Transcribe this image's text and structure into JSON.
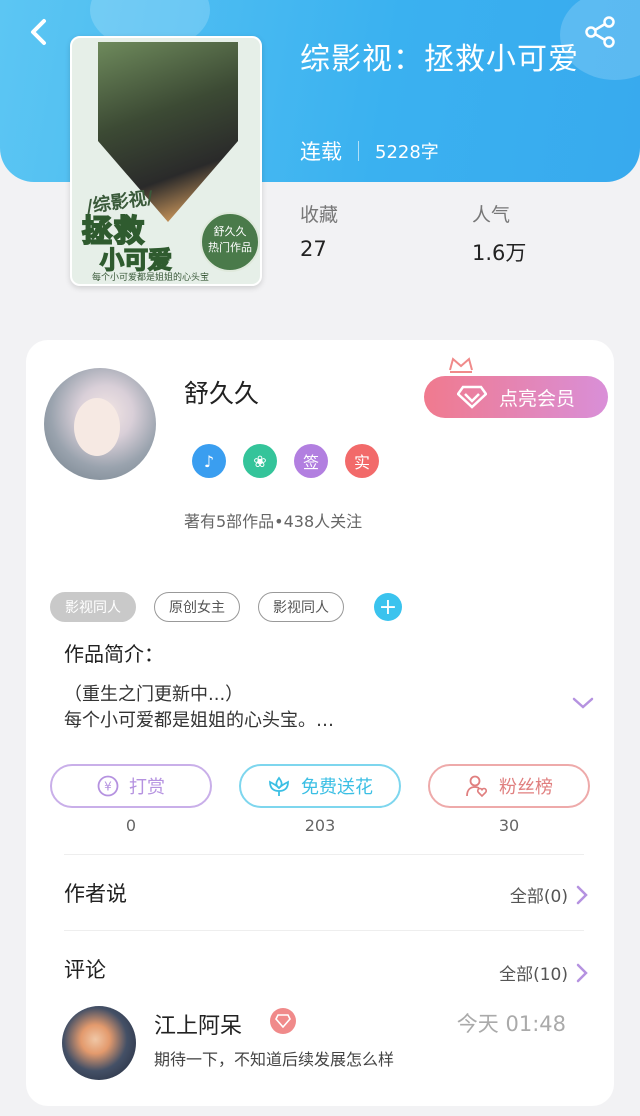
{
  "header": {
    "back_icon": "chevron-left-icon",
    "share_icon": "share-icon"
  },
  "book": {
    "title": "综影视：拯救小可爱",
    "status": "连载",
    "word_count": "5228字",
    "cover": {
      "top_text": "/综影视/",
      "main_text_1": "拯救",
      "main_text_2": "小可爱",
      "seal_name": "舒久久",
      "seal_tag": "热门作品",
      "bottom_text": "每个小可爱都是姐姐的心头宝"
    },
    "stats": {
      "favorites_label": "收藏",
      "favorites_value": "27",
      "popularity_label": "人气",
      "popularity_value": "1.6万"
    }
  },
  "author": {
    "name": "舒久久",
    "vip_label": "点亮会员",
    "badges": [
      {
        "name": "music-badge-icon",
        "glyph": "♪",
        "color": "#3a9ef0"
      },
      {
        "name": "handshake-badge-icon",
        "glyph": "❀",
        "color": "#34c49a"
      },
      {
        "name": "sign-badge-icon",
        "glyph": "签",
        "color": "#b27fe0"
      },
      {
        "name": "real-badge-icon",
        "glyph": "实",
        "color": "#f26a6a"
      }
    ],
    "works_info": "著有5部作品•438人关注"
  },
  "tags": [
    "影视同人",
    "原创女主",
    "影视同人"
  ],
  "intro": {
    "title": "作品简介：",
    "line1": "（重生之门更新中...）",
    "line2": "每个小可爱都是姐姐的心头宝。…"
  },
  "actions": [
    {
      "label": "打赏",
      "count": "0",
      "color": "#b592e0"
    },
    {
      "label": "免费送花",
      "count": "203",
      "color": "#4cc6e6"
    },
    {
      "label": "粉丝榜",
      "count": "30",
      "color": "#e88b8b"
    }
  ],
  "author_says": {
    "title": "作者说",
    "all_label": "全部(0)"
  },
  "comments": {
    "title": "评论",
    "all_label": "全部(10)",
    "items": [
      {
        "user": "江上阿呆",
        "time": "今天 01:48",
        "text": "期待一下，不知道后续发展怎么样"
      }
    ]
  }
}
